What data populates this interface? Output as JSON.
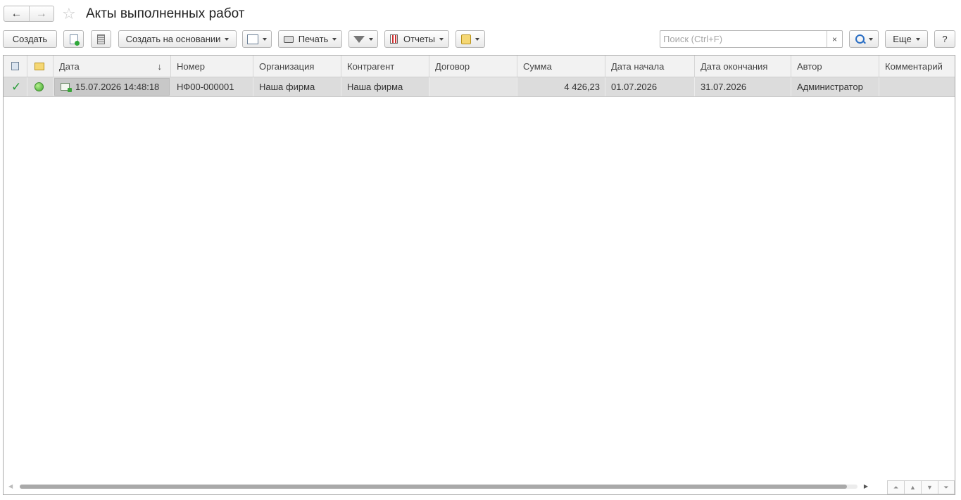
{
  "window": {
    "title": "Акты выполненных работ",
    "back_icon": "←",
    "forward_icon": "→",
    "star_icon": "☆"
  },
  "toolbar": {
    "create_label": "Создать",
    "create_based_on_label": "Создать на основании",
    "print_label": "Печать",
    "reports_label": "Отчеты",
    "search_placeholder": "Поиск (Ctrl+F)",
    "search_clear": "×",
    "more_label": "Еще",
    "help_label": "?"
  },
  "table": {
    "columns": [
      "Дата",
      "Номер",
      "Организация",
      "Контрагент",
      "Договор",
      "Сумма",
      "Дата начала",
      "Дата окончания",
      "Автор",
      "Комментарий"
    ],
    "sort_indicator": "↓",
    "rows": [
      {
        "posted_icon": "✓",
        "date": "15.07.2026 14:48:18",
        "number": "НФ00-000001",
        "organization": "Наша фирма",
        "counterparty": "Наша фирма",
        "contract": "",
        "amount": "4 426,23",
        "start_date": "01.07.2026",
        "end_date": "31.07.2026",
        "author": "Администратор",
        "comment": ""
      }
    ]
  },
  "pager": {
    "first": "⏶",
    "prev": "▲",
    "next": "▼",
    "last": "⏷"
  },
  "colors": {
    "accent": "#2a6ec4",
    "selected_row": "#dcdcdc",
    "posted_check": "#2a9d3a"
  }
}
